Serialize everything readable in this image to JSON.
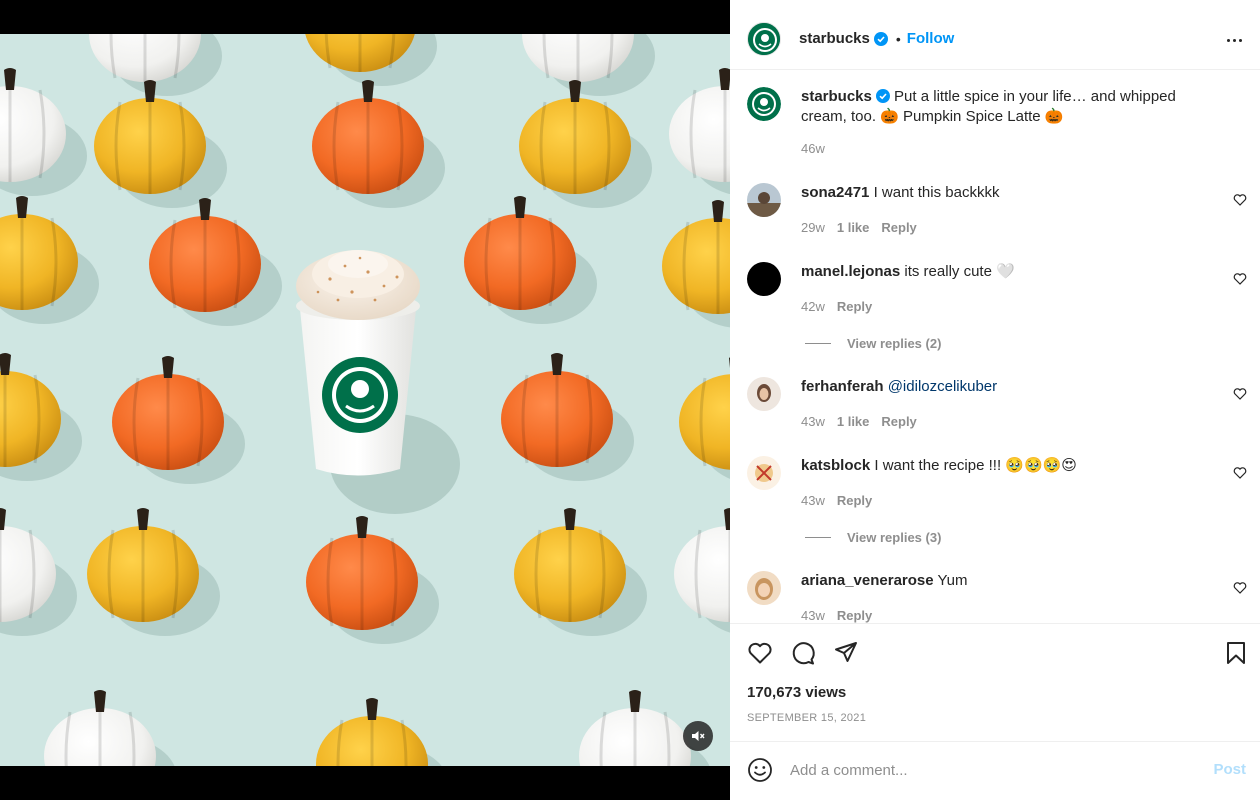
{
  "post": {
    "username": "starbucks",
    "follow_label": "Follow",
    "separator": "•"
  },
  "caption": {
    "username": "starbucks",
    "text": "Put a little spice in your life… and whipped cream, too. 🎃 Pumpkin Spice Latte 🎃",
    "time": "46w"
  },
  "comments": [
    {
      "username": "sona2471",
      "text": "I want this backkkk",
      "time": "29w",
      "likes": "1 like",
      "reply": "Reply",
      "avatar_color": "#8a7d6d"
    },
    {
      "username": "manel.lejonas",
      "text": "its really cute 🤍",
      "time": "42w",
      "likes": "",
      "reply": "Reply",
      "avatar_color": "#000000",
      "view_replies": "View replies (2)"
    },
    {
      "username": "ferhanferah",
      "text": "@idilozcelikuber",
      "time": "43w",
      "likes": "1 like",
      "reply": "Reply",
      "avatar_color": "#d9c8bd"
    },
    {
      "username": "katsblock",
      "text": "I want the recipe !!! 🥹🥹🥹😍",
      "time": "43w",
      "likes": "",
      "reply": "Reply",
      "avatar_color": "#f3e2c9",
      "view_replies": "View replies (3)"
    },
    {
      "username": "ariana_venerarose",
      "text": "Yum",
      "time": "43w",
      "likes": "",
      "reply": "Reply",
      "avatar_color": "#e7c9a8"
    }
  ],
  "stats": {
    "views": "170,673 views",
    "date": "SEPTEMBER 15, 2021"
  },
  "composer": {
    "placeholder": "Add a comment...",
    "post_label": "Post"
  },
  "colors": {
    "accent": "#0095f6",
    "brand_green": "#00704a",
    "post_disabled": "#b2dffc",
    "muted": "#8e8e8e"
  },
  "icons": [
    "verified-badge-icon",
    "more-options-icon",
    "heart-icon",
    "comment-icon",
    "share-icon",
    "bookmark-icon",
    "emoji-icon",
    "mute-icon"
  ]
}
